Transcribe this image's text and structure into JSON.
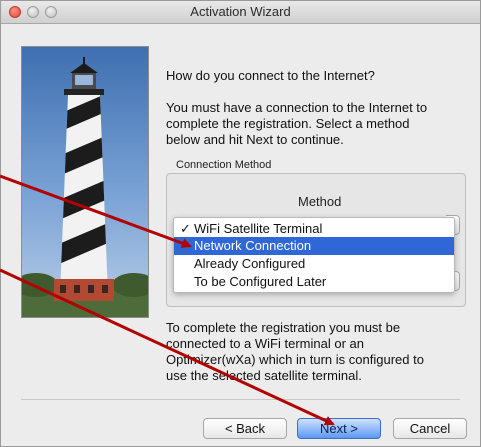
{
  "window": {
    "title": "Activation Wizard"
  },
  "intro": {
    "question": "How do you connect to the Internet?",
    "lines": [
      "You must have a connection to the Internet to",
      "complete the registration. Select a method",
      "below and hit Next to continue."
    ]
  },
  "connection_method": {
    "group_label": "Connection Method",
    "column_label": "Method",
    "checkmark": "✓",
    "selected_value": "WiFi Satellite Terminal",
    "options": [
      {
        "label": "WiFi Satellite Terminal",
        "checked": true,
        "highlighted": false
      },
      {
        "label": "Network Connection",
        "checked": false,
        "highlighted": true
      },
      {
        "label": "Already Configured",
        "checked": false,
        "highlighted": false
      },
      {
        "label": "To be Configured Later",
        "checked": false,
        "highlighted": false
      }
    ]
  },
  "note": {
    "lines": [
      "To complete the registration you must be",
      "connected to a WiFi terminal or an",
      "Optimizer(wXa) which in turn is configured to",
      "use the selected satellite terminal."
    ]
  },
  "buttons": {
    "back": "< Back",
    "next": "Next >",
    "cancel": "Cancel"
  },
  "colors": {
    "highlight": "#2f67d6",
    "annotation_arrow": "#b30000"
  }
}
